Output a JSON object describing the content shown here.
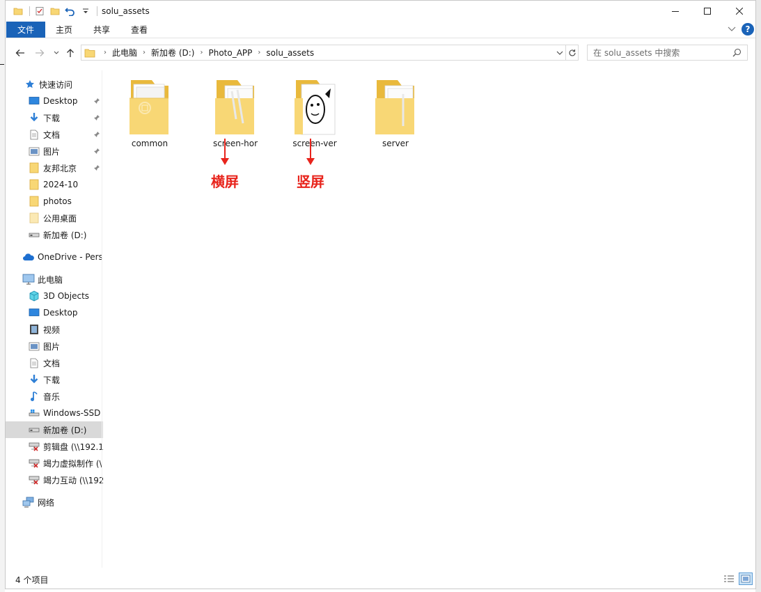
{
  "window": {
    "title": "solu_assets"
  },
  "ribbon": {
    "tabs": [
      "文件",
      "主页",
      "共享",
      "查看"
    ]
  },
  "address": {
    "crumbs": [
      "此电脑",
      "新加卷 (D:)",
      "Photo_APP",
      "solu_assets"
    ]
  },
  "search": {
    "placeholder": "在 solu_assets 中搜索"
  },
  "sidebar": {
    "items": [
      {
        "label": "快速访问",
        "icon": "star-icon"
      },
      {
        "label": "Desktop",
        "icon": "desktop-icon",
        "pinned": true
      },
      {
        "label": "下载",
        "icon": "download-icon",
        "pinned": true
      },
      {
        "label": "文档",
        "icon": "document-icon",
        "pinned": true
      },
      {
        "label": "图片",
        "icon": "pictures-icon",
        "pinned": true
      },
      {
        "label": "友邦北京",
        "icon": "folder-icon",
        "pinned": true
      },
      {
        "label": "2024-10",
        "icon": "folder-icon"
      },
      {
        "label": "photos",
        "icon": "folder-icon"
      },
      {
        "label": "公用桌面",
        "icon": "folder-icon"
      },
      {
        "label": "新加卷 (D:)",
        "icon": "drive-icon"
      },
      {
        "label": "OneDrive - Pers",
        "icon": "onedrive-icon"
      },
      {
        "label": "此电脑",
        "icon": "computer-icon"
      },
      {
        "label": "3D Objects",
        "icon": "3d-objects-icon"
      },
      {
        "label": "Desktop",
        "icon": "desktop-icon"
      },
      {
        "label": "视频",
        "icon": "video-icon"
      },
      {
        "label": "图片",
        "icon": "pictures-icon"
      },
      {
        "label": "文档",
        "icon": "document-icon"
      },
      {
        "label": "下载",
        "icon": "download-icon"
      },
      {
        "label": "音乐",
        "icon": "music-icon"
      },
      {
        "label": "Windows-SSD",
        "icon": "windows-drive-icon"
      },
      {
        "label": "新加卷 (D:)",
        "icon": "drive-icon",
        "selected": true
      },
      {
        "label": "剪辑盘 (\\\\192.1",
        "icon": "network-drive-disconnected-icon"
      },
      {
        "label": "竭力虚拟制作 (\\",
        "icon": "network-drive-disconnected-icon"
      },
      {
        "label": "竭力互动 (\\\\192",
        "icon": "network-drive-disconnected-icon"
      },
      {
        "label": "网络",
        "icon": "network-icon"
      }
    ]
  },
  "content": {
    "folders": [
      "common",
      "screen-hor",
      "screen-ver",
      "server"
    ],
    "annotations": [
      "横屏",
      "竖屏"
    ]
  },
  "status": {
    "item_count": "4 个项目"
  },
  "colors": {
    "accent": "#1a63b8",
    "folder": "#f8d775",
    "annotation": "#e8241c",
    "selected": "#d9d9d9"
  }
}
